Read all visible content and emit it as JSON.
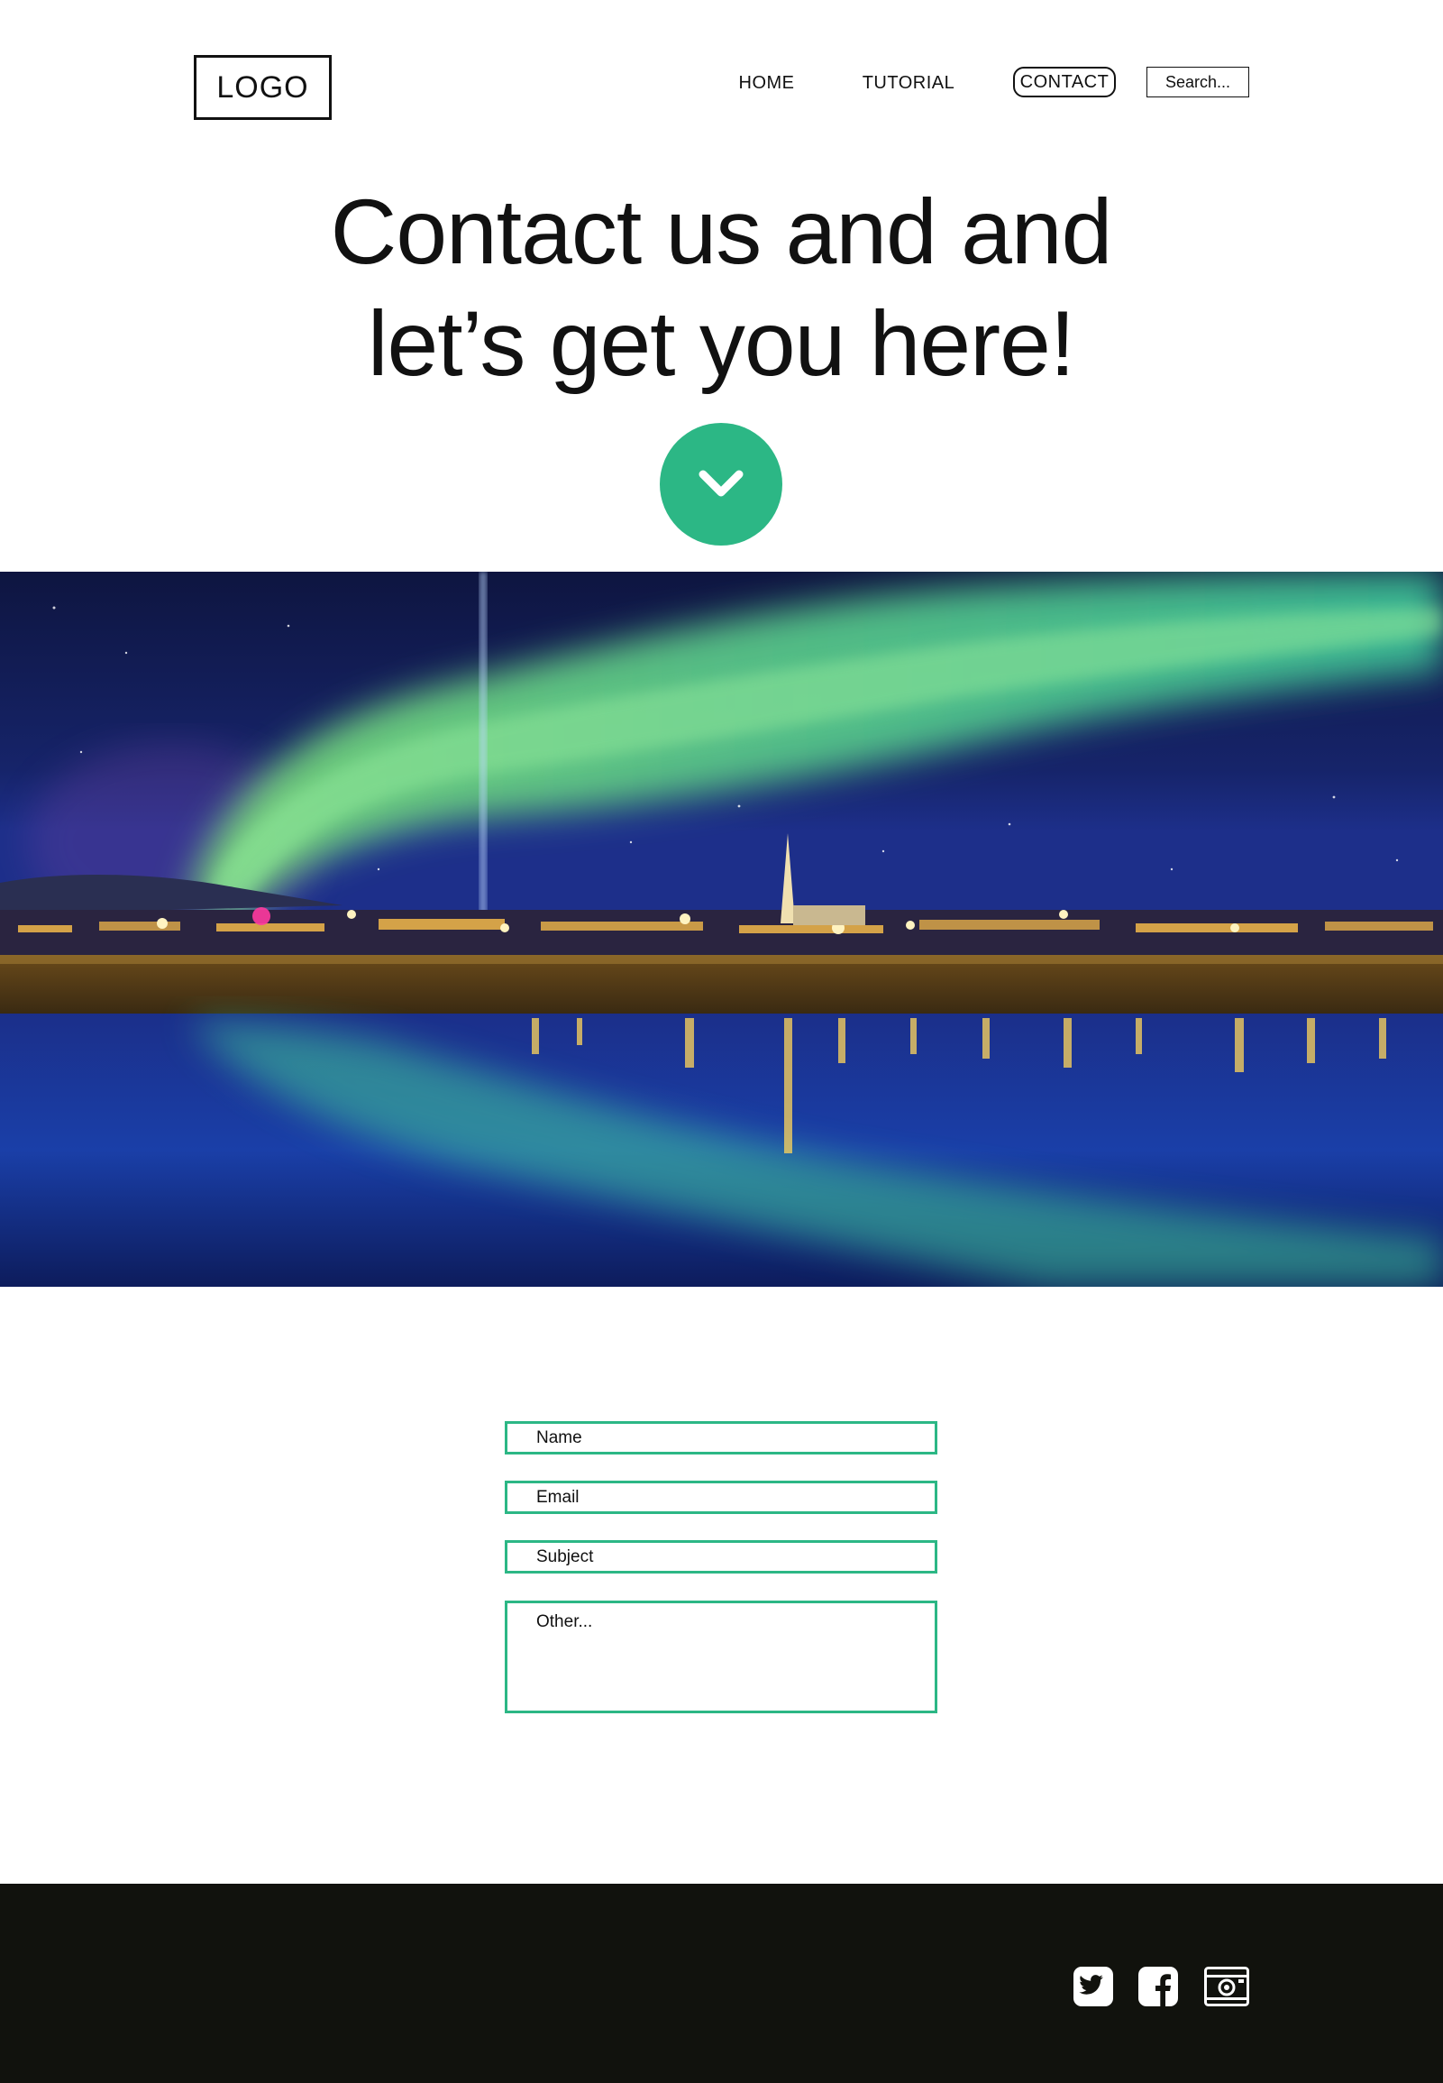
{
  "header": {
    "logo": "LOGO",
    "nav": {
      "home": "HOME",
      "tutorial": "TUTORIAL",
      "contact": "CONTACT"
    },
    "search_placeholder": "Search..."
  },
  "hero": {
    "headline_line1": "Contact us and and",
    "headline_line2": "let’s get you here!"
  },
  "form": {
    "name_placeholder": "Name",
    "email_placeholder": "Email",
    "subject_placeholder": "Subject",
    "other_placeholder": "Other..."
  },
  "footer": {
    "social": [
      "twitter-icon",
      "facebook-icon",
      "instagram-icon"
    ]
  },
  "colors": {
    "accent": "#2cb785",
    "footer_bg": "#11120d",
    "text": "#111111"
  }
}
